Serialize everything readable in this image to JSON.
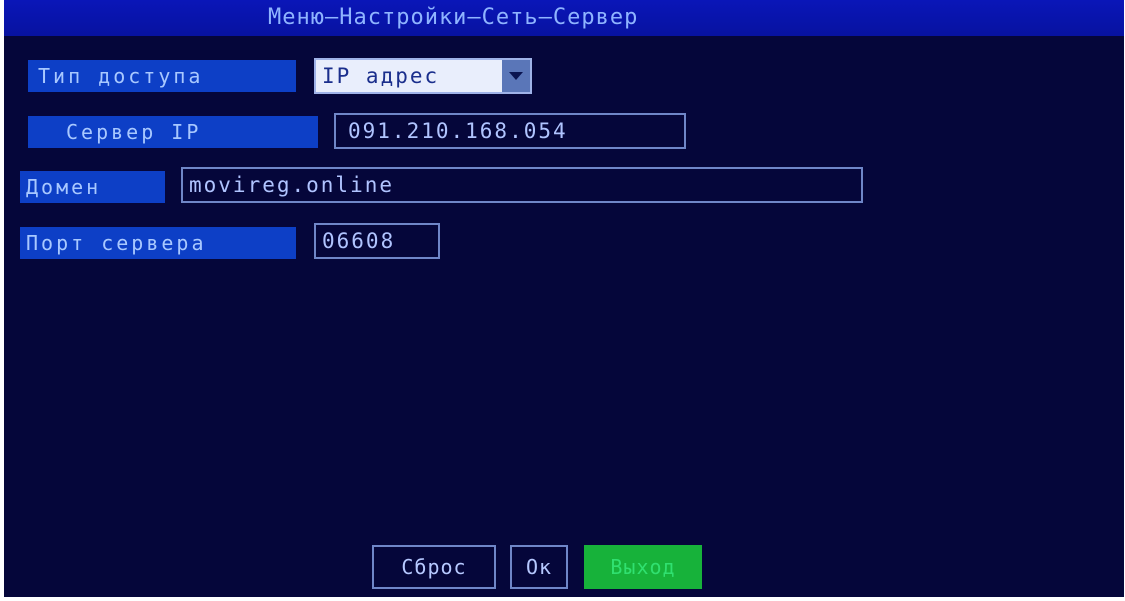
{
  "title": "Меню–Настройки–Сеть–Сервер",
  "fields": {
    "access_type": {
      "label": "Тип доступа",
      "value": "IP адрес"
    },
    "server_ip": {
      "label": "Сервер IP",
      "value": "091.210.168.054"
    },
    "domain": {
      "label": "Домен",
      "value": "movireg.online"
    },
    "server_port": {
      "label": "Порт сервера",
      "value": "06608"
    }
  },
  "buttons": {
    "reset": "Сброс",
    "ok": "Ок",
    "exit": "Выход"
  },
  "colors": {
    "background": "#05063a",
    "title_bar": "#0a16b8",
    "label_bg": "#0d3fc6",
    "active_button": "#17b23a"
  },
  "icons": {
    "dropdown": "chevron-down-icon"
  }
}
